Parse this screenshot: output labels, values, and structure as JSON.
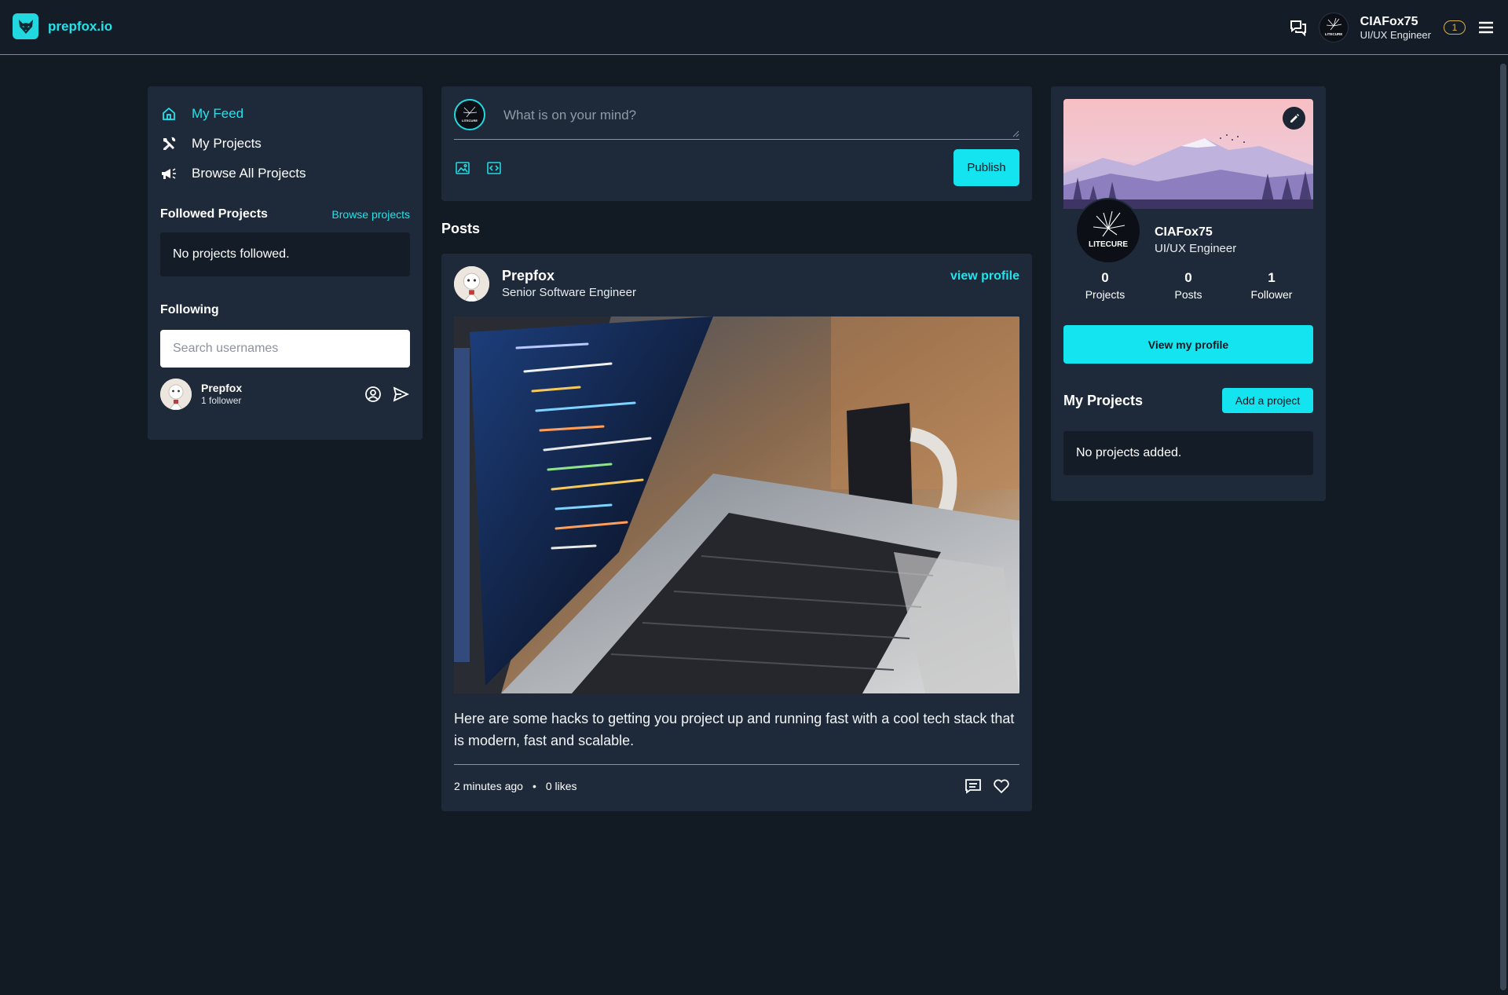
{
  "header": {
    "brand": "prepfox.io",
    "user_name": "CIAFox75",
    "user_role": "UI/UX Engineer",
    "notification_count": "1",
    "avatar_text": "LITECURE"
  },
  "sidebar": {
    "nav": [
      {
        "label": "My Feed",
        "icon": "home-icon",
        "active": true
      },
      {
        "label": "My Projects",
        "icon": "tools-icon",
        "active": false
      },
      {
        "label": "Browse All Projects",
        "icon": "megaphone-icon",
        "active": false
      }
    ],
    "followed_projects_title": "Followed Projects",
    "browse_projects_link": "Browse projects",
    "no_projects_followed": "No projects followed.",
    "following_title": "Following",
    "search_placeholder": "Search usernames",
    "following": [
      {
        "name": "Prepfox",
        "followers": "1 follower"
      }
    ]
  },
  "composer": {
    "placeholder": "What is on your mind?",
    "publish_label": "Publish"
  },
  "posts_title": "Posts",
  "post": {
    "author": "Prepfox",
    "role": "Senior Software Engineer",
    "view_profile": "view profile",
    "text": "Here are some hacks to getting you project up and running fast with a cool tech stack that is modern, fast and scalable.",
    "time": "2 minutes ago",
    "dot": "•",
    "likes": "0 likes"
  },
  "profile_card": {
    "name": "CIAFox75",
    "role": "UI/UX Engineer",
    "avatar_text": "LITECURE",
    "stats": [
      {
        "value": "0",
        "label": "Projects"
      },
      {
        "value": "0",
        "label": "Posts"
      },
      {
        "value": "1",
        "label": "Follower"
      }
    ],
    "view_profile_label": "View my profile",
    "my_projects_title": "My Projects",
    "add_project_label": "Add a project",
    "no_projects_added": "No projects added."
  },
  "colors": {
    "accent": "#14e4ef",
    "background": "#121a24",
    "panel": "#1e2a39"
  }
}
